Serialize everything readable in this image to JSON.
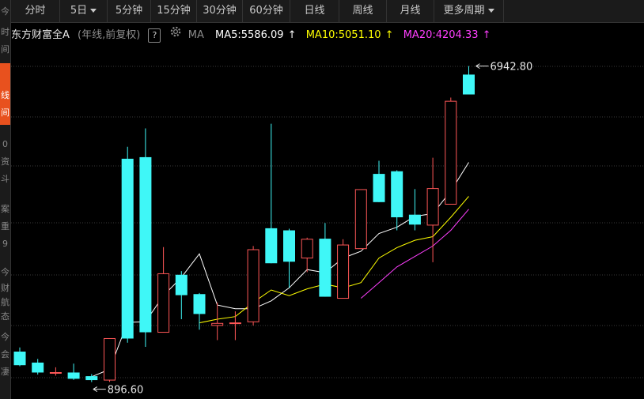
{
  "tabs": [
    {
      "label": "分时"
    },
    {
      "label": "5日",
      "dropdown": true
    },
    {
      "label": "5分钟"
    },
    {
      "label": "15分钟"
    },
    {
      "label": "30分钟"
    },
    {
      "label": "60分钟"
    },
    {
      "label": "日线"
    },
    {
      "label": "周线"
    },
    {
      "label": "月线"
    },
    {
      "label": "更多周期",
      "dropdown": true
    }
  ],
  "left_rail": [
    "今",
    "时",
    "间",
    "线",
    "间",
    "0",
    "资",
    "斗",
    "案",
    "重",
    "9",
    "今",
    "财",
    "航",
    "态",
    "今",
    "会",
    "凄"
  ],
  "header": {
    "stock_name": "东方财富全A",
    "period_note": "(年线,前复权)",
    "help": "?",
    "ma_label": "MA",
    "ma5": "MA5:5586.09",
    "ma10": "MA10:5051.10",
    "ma20": "MA20:4204.33",
    "arrow": "↑"
  },
  "colors": {
    "up": "#ff5757",
    "down": "#3ff7f7",
    "ma5": "#ffffff",
    "ma10": "#ffff00",
    "ma20": "#ff3fff",
    "grid": "#3a3a3a",
    "background": "#000000"
  },
  "chart_data": {
    "type": "candlestick",
    "max_label": "6942.80",
    "min_label": "896.60",
    "ylim": [
      800,
      7300
    ],
    "candles": [
      {
        "o": 1480,
        "c": 1220,
        "h": 1560,
        "l": 1200
      },
      {
        "o": 1270,
        "c": 1080,
        "h": 1340,
        "l": 1040
      },
      {
        "o": 1080,
        "c": 1080,
        "h": 1180,
        "l": 1020
      },
      {
        "o": 1080,
        "c": 960,
        "h": 1250,
        "l": 940
      },
      {
        "o": 1010,
        "c": 935,
        "h": 1050,
        "l": 896.6
      },
      {
        "o": 935,
        "c": 1730,
        "h": 1730,
        "l": 900
      },
      {
        "o": 5170,
        "c": 1730,
        "h": 5400,
        "l": 1650
      },
      {
        "o": 5200,
        "c": 1850,
        "h": 5750,
        "l": 1570
      },
      {
        "o": 1850,
        "c": 2970,
        "h": 3480,
        "l": 1850
      },
      {
        "o": 2950,
        "c": 2560,
        "h": 3020,
        "l": 2100
      },
      {
        "o": 2580,
        "c": 2200,
        "h": 2600,
        "l": 1900
      },
      {
        "o": 1980,
        "c": 2020,
        "h": 2420,
        "l": 1700
      },
      {
        "o": 2020,
        "c": 2030,
        "h": 2250,
        "l": 1700
      },
      {
        "o": 2050,
        "c": 3430,
        "h": 3500,
        "l": 1980
      },
      {
        "o": 3840,
        "c": 3170,
        "h": 5840,
        "l": 3170
      },
      {
        "o": 3800,
        "c": 3200,
        "h": 3830,
        "l": 2700
      },
      {
        "o": 3270,
        "c": 3630,
        "h": 3660,
        "l": 3000
      },
      {
        "o": 3640,
        "c": 2530,
        "h": 3940,
        "l": 2530
      },
      {
        "o": 2500,
        "c": 3520,
        "h": 3630,
        "l": 2500
      },
      {
        "o": 3450,
        "c": 4580,
        "h": 4580,
        "l": 3450
      },
      {
        "o": 4880,
        "c": 4340,
        "h": 5130,
        "l": 4340
      },
      {
        "o": 4930,
        "c": 4050,
        "h": 4950,
        "l": 3800
      },
      {
        "o": 4100,
        "c": 3910,
        "h": 4590,
        "l": 3800
      },
      {
        "o": 3900,
        "c": 4600,
        "h": 5190,
        "l": 3190
      },
      {
        "o": 4300,
        "c": 6270,
        "h": 6340,
        "l": 4300
      },
      {
        "o": 6780,
        "c": 6400,
        "h": 6942.8,
        "l": 6400
      }
    ],
    "ma5": [
      null,
      null,
      null,
      null,
      1000,
      1140,
      2040,
      2050,
      2550,
      2900,
      3350,
      2370,
      2300,
      2300,
      2450,
      2700,
      3050,
      2990,
      3270,
      3400,
      3740,
      3860,
      4070,
      4120,
      4550,
      5100
    ],
    "ma10": [
      null,
      null,
      null,
      null,
      null,
      null,
      null,
      null,
      null,
      null,
      2030,
      2100,
      2150,
      2420,
      2660,
      2550,
      2680,
      2770,
      2700,
      2800,
      3270,
      3470,
      3610,
      3680,
      4050,
      4450
    ],
    "ma20": [
      null,
      null,
      null,
      null,
      null,
      null,
      null,
      null,
      null,
      null,
      null,
      null,
      null,
      null,
      null,
      null,
      null,
      null,
      null,
      2500,
      2800,
      3100,
      3300,
      3500,
      3800,
      4204.33
    ]
  }
}
